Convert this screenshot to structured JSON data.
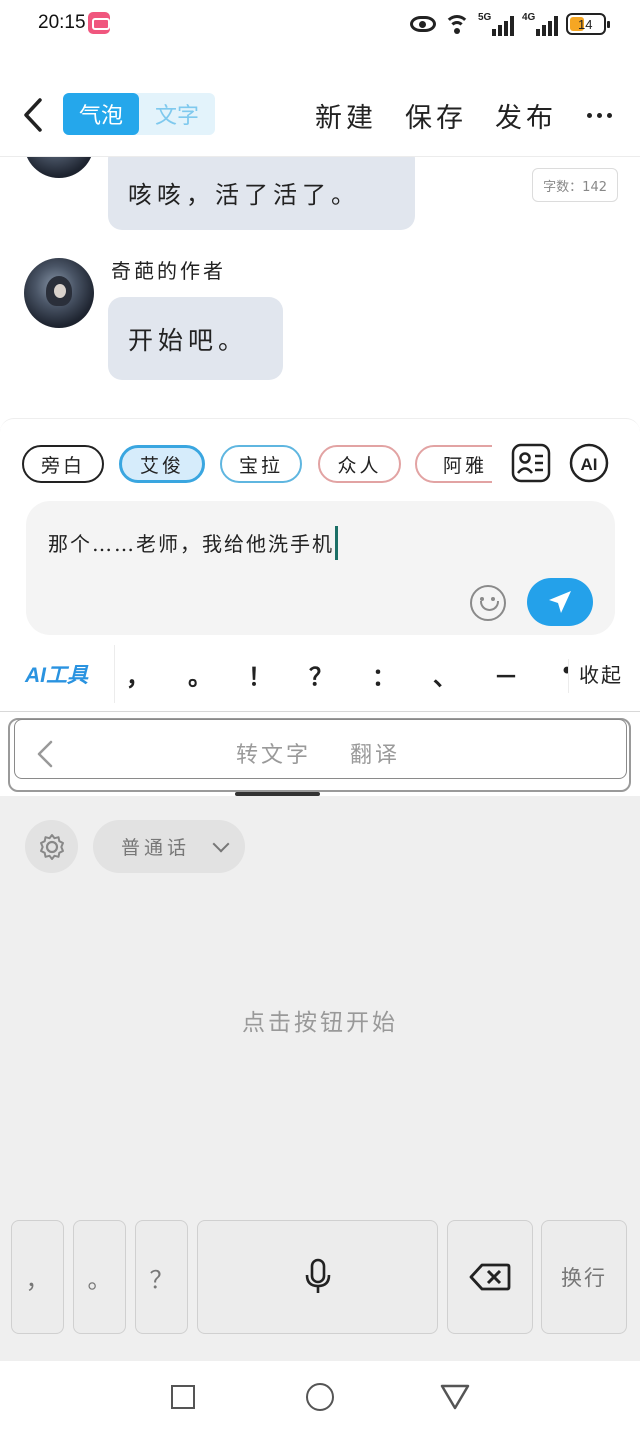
{
  "status_bar": {
    "time": "20:15",
    "signal_5g": "5G",
    "signal_4g": "4G",
    "battery_level": "14",
    "icons": [
      "app-badge-icon",
      "eye-icon",
      "wifi-icon",
      "signal-icon",
      "battery-icon"
    ]
  },
  "top_bar": {
    "mode_bubble": "气泡",
    "mode_text": "文字",
    "actions": {
      "new": "新建",
      "save": "保存",
      "publish": "发布"
    }
  },
  "chat": {
    "word_count": "字数：142",
    "messages": [
      {
        "text": "咳咳，活了活了。"
      },
      {
        "sender": "奇葩的作者",
        "text": "开始吧。"
      }
    ]
  },
  "composer": {
    "roles": [
      {
        "label": "旁白",
        "border": "#222222",
        "bg": "#ffffff"
      },
      {
        "label": "艾俊",
        "border": "#3aa6e0",
        "bg": "#d6ecfb"
      },
      {
        "label": "宝拉",
        "border": "#5fb6e0",
        "bg": "#ffffff"
      },
      {
        "label": "众人",
        "border": "#e2a3a3",
        "bg": "#ffffff"
      },
      {
        "label": "阿雅",
        "border": "#e2a3a3",
        "bg": "#ffffff"
      }
    ],
    "ai_badge": "AI",
    "input_value": "那个……老师，我给他洗手机",
    "ai_tools": "AI工具",
    "punctuation": [
      "，",
      "。",
      "！",
      "？",
      "：",
      "、",
      "－",
      "•"
    ],
    "collapse": "收起",
    "send_color": "#24a1ea"
  },
  "keyboard": {
    "header": {
      "convert": "转文字",
      "translate": "翻译"
    },
    "language": "普通话",
    "hint": "点击按钮开始",
    "keys": {
      "comma": "，",
      "period": "。",
      "question": "？",
      "newline": "换行"
    }
  },
  "colors": {
    "accent": "#25a7eb",
    "bubble": "#e1e6ee"
  }
}
